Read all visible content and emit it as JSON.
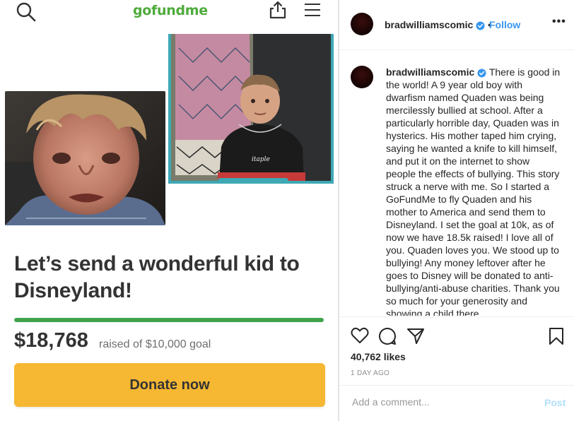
{
  "gofundme": {
    "logo": "gofundme",
    "title": "Let’s send a wonderful kid to Disneyland!",
    "raised_amount": "$18,768",
    "raised_of": "raised of $10,000 goal",
    "progress_fraction": 1.0,
    "donate_label": "Donate now",
    "brand_color": "#4eab3b",
    "donate_color": "#f6b832"
  },
  "instagram": {
    "username": "bradwilliamscomic",
    "follow_label": "Follow",
    "caption_user": "bradwilliamscomic",
    "caption_text": "There is good in the world! A 9 year old boy with dwarfism named Quaden was being mercilessly bullied at school. After a particularly horrible day, Quaden was in hysterics. His mother taped him crying, saying he wanted a knife to kill himself, and put it on the internet to show people the effects of bullying. This story struck a nerve with me. So I started a GoFundMe to fly Quaden and his mother to America and send them to Disneyland. I set the goal at 10k, as of now we have 18.5k raised! I love all of you. Quaden loves you. We stood up to bullying! Any money leftover after he goes to Disney will be donated to anti-bullying/anti-abuse charities. Thank you so much for your generosity and showing a child there",
    "likes": "40,762 likes",
    "time": "1 DAY AGO",
    "comment_placeholder": "Add a comment...",
    "post_label": "Post",
    "accent_color": "#3897f0"
  }
}
